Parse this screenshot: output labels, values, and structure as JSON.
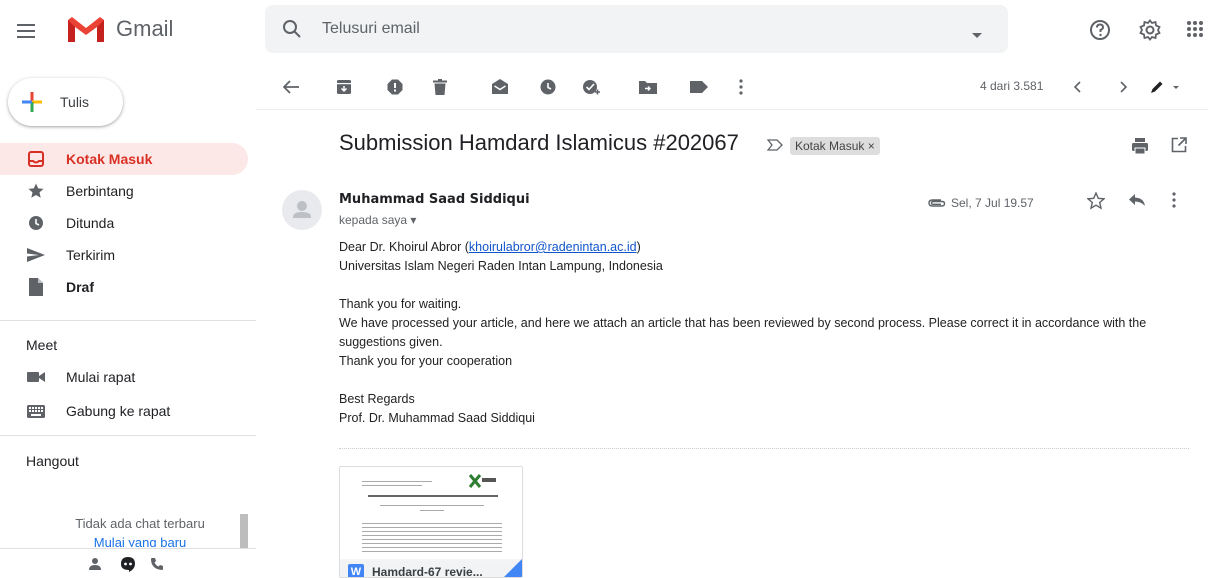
{
  "app": {
    "name": "Gmail"
  },
  "search": {
    "placeholder": "Telusuri email"
  },
  "compose": {
    "label": "Tulis"
  },
  "nav": [
    {
      "label": "Kotak Masuk",
      "icon": "inbox-icon",
      "active": true
    },
    {
      "label": "Berbintang",
      "icon": "star-icon"
    },
    {
      "label": "Ditunda",
      "icon": "clock-icon"
    },
    {
      "label": "Terkirim",
      "icon": "send-icon"
    },
    {
      "label": "Draf",
      "icon": "draft-icon",
      "bold": true
    }
  ],
  "meet": {
    "title": "Meet",
    "items": [
      {
        "label": "Mulai rapat",
        "icon": "video-icon"
      },
      {
        "label": "Gabung ke rapat",
        "icon": "keyboard-icon"
      }
    ]
  },
  "hangout": {
    "title": "Hangout",
    "empty": "Tidak ada chat terbaru",
    "start_link": "Mulai yang baru"
  },
  "toolbar": {
    "count": "4 dari 3.581"
  },
  "message": {
    "subject": "Submission Hamdard Islamicus #202067",
    "label": "Kotak Masuk ×",
    "sender": "Muhammad Saad Siddiqui",
    "to": "kepada saya ▾",
    "date": "Sel, 7 Jul 19.57",
    "greeting": "Dear Dr. Khoirul Abror (",
    "email": "khoirulabror@radenintan.ac.id",
    "greeting_end": ")",
    "line2": "Universitas Islam Negeri Raden Intan Lampung, Indonesia",
    "line3": "Thank you for waiting.",
    "line4": "We have processed your article, and here we attach an article that has been reviewed by second process. Please correct it in accordance with the suggestions given.",
    "line5": "Thank you for your cooperation",
    "line6": "Best Regards",
    "line7": "Prof. Dr. Muhammad Saad Siddiqui"
  },
  "attachment": {
    "name": "Hamdard-67 revie..."
  },
  "colors": {
    "accent": "#d93025",
    "active_bg": "#fce8e6",
    "link": "#1155cc"
  }
}
